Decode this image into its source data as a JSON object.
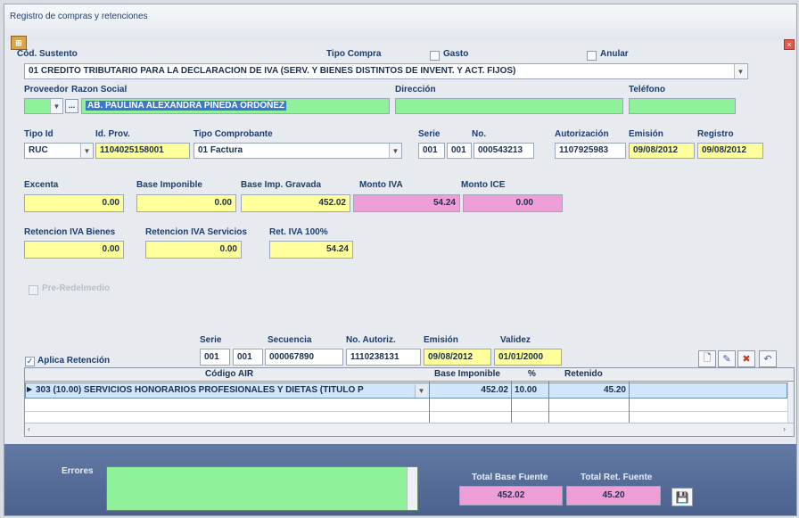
{
  "window": {
    "title": "Registro de compras y retenciones"
  },
  "header": {
    "cod_sustento_label": "Cód. Sustento",
    "tipo_compra_label": "Tipo Compra",
    "gasto_label": "Gasto",
    "anular_label": "Anular",
    "cod_sustento_value": "01 CREDITO TRIBUTARIO PARA LA DECLARACION DE IVA (SERV. Y BIENES DISTINTOS DE INVENT. Y ACT. FIJOS)"
  },
  "proveedor": {
    "proveedor_label": "Proveedor",
    "razon_social_label": "Razon Social",
    "direccion_label": "Dirección",
    "telefono_label": "Teléfono",
    "razon_social_value": "AB. PAULINA ALEXANDRA PINEDA ORDOÑEZ",
    "lookup_button": "..."
  },
  "comprobante": {
    "tipo_id_label": "Tipo Id",
    "id_prov_label": "Id. Prov.",
    "tipo_comprobante_label": "Tipo Comprobante",
    "serie_label": "Serie",
    "no_label": "No.",
    "autorizacion_label": "Autorización",
    "emision_label": "Emisión",
    "registro_label": "Registro",
    "tipo_id_value": "RUC",
    "id_prov_value": "1104025158001",
    "tipo_comprobante_value": "01 Factura",
    "serie_1": "001",
    "serie_2": "001",
    "no_value": "000543213",
    "autorizacion_value": "1107925983",
    "emision_value": "09/08/2012",
    "registro_value": "09/08/2012"
  },
  "montos": {
    "excenta_label": "Excenta",
    "base_imponible_label": "Base Imponible",
    "base_gravada_label": "Base Imp. Gravada",
    "monto_iva_label": "Monto IVA",
    "monto_ice_label": "Monto ICE",
    "excenta_value": "0.00",
    "base_imponible_value": "0.00",
    "base_gravada_value": "452.02",
    "monto_iva_value": "54.24",
    "monto_ice_value": "0.00"
  },
  "retenciones_iva": {
    "bienes_label": "Retencion IVA Bienes",
    "servicios_label": "Retencion IVA Servicios",
    "ret100_label": "Ret. IVA 100%",
    "bienes_value": "0.00",
    "servicios_value": "0.00",
    "ret100_value": "54.24"
  },
  "extra_check_label": "Pre-Redelmedio",
  "retencion": {
    "aplica_label": "Aplica Retención",
    "serie_label": "Serie",
    "secuencia_label": "Secuencia",
    "no_autoriz_label": "No. Autoriz.",
    "emision_label": "Emisión",
    "validez_label": "Validez",
    "serie_1": "001",
    "serie_2": "001",
    "secuencia_value": "000067890",
    "no_autoriz_value": "1110238131",
    "emision_value": "09/08/2012",
    "validez_value": "01/01/2000"
  },
  "grid": {
    "headers": {
      "codigo": "Código AIR",
      "base": "Base Imponible",
      "pct": "%",
      "retenido": "Retenido"
    },
    "row": {
      "codigo": "303  (10.00)  SERVICIOS HONORARIOS PROFESIONALES Y DIETAS (TITULO P",
      "base": "452.02",
      "pct": "10.00",
      "retenido": "45.20"
    }
  },
  "footer": {
    "errores_label": "Errores",
    "total_base_label": "Total Base Fuente",
    "total_ret_label": "Total Ret. Fuente",
    "total_base_value": "452.02",
    "total_ret_value": "45.20"
  },
  "colors": {
    "yellow": "#ffff9b",
    "pink": "#ee9fd8",
    "green": "#8ff29a",
    "selected_row": "#cfe6fb"
  }
}
